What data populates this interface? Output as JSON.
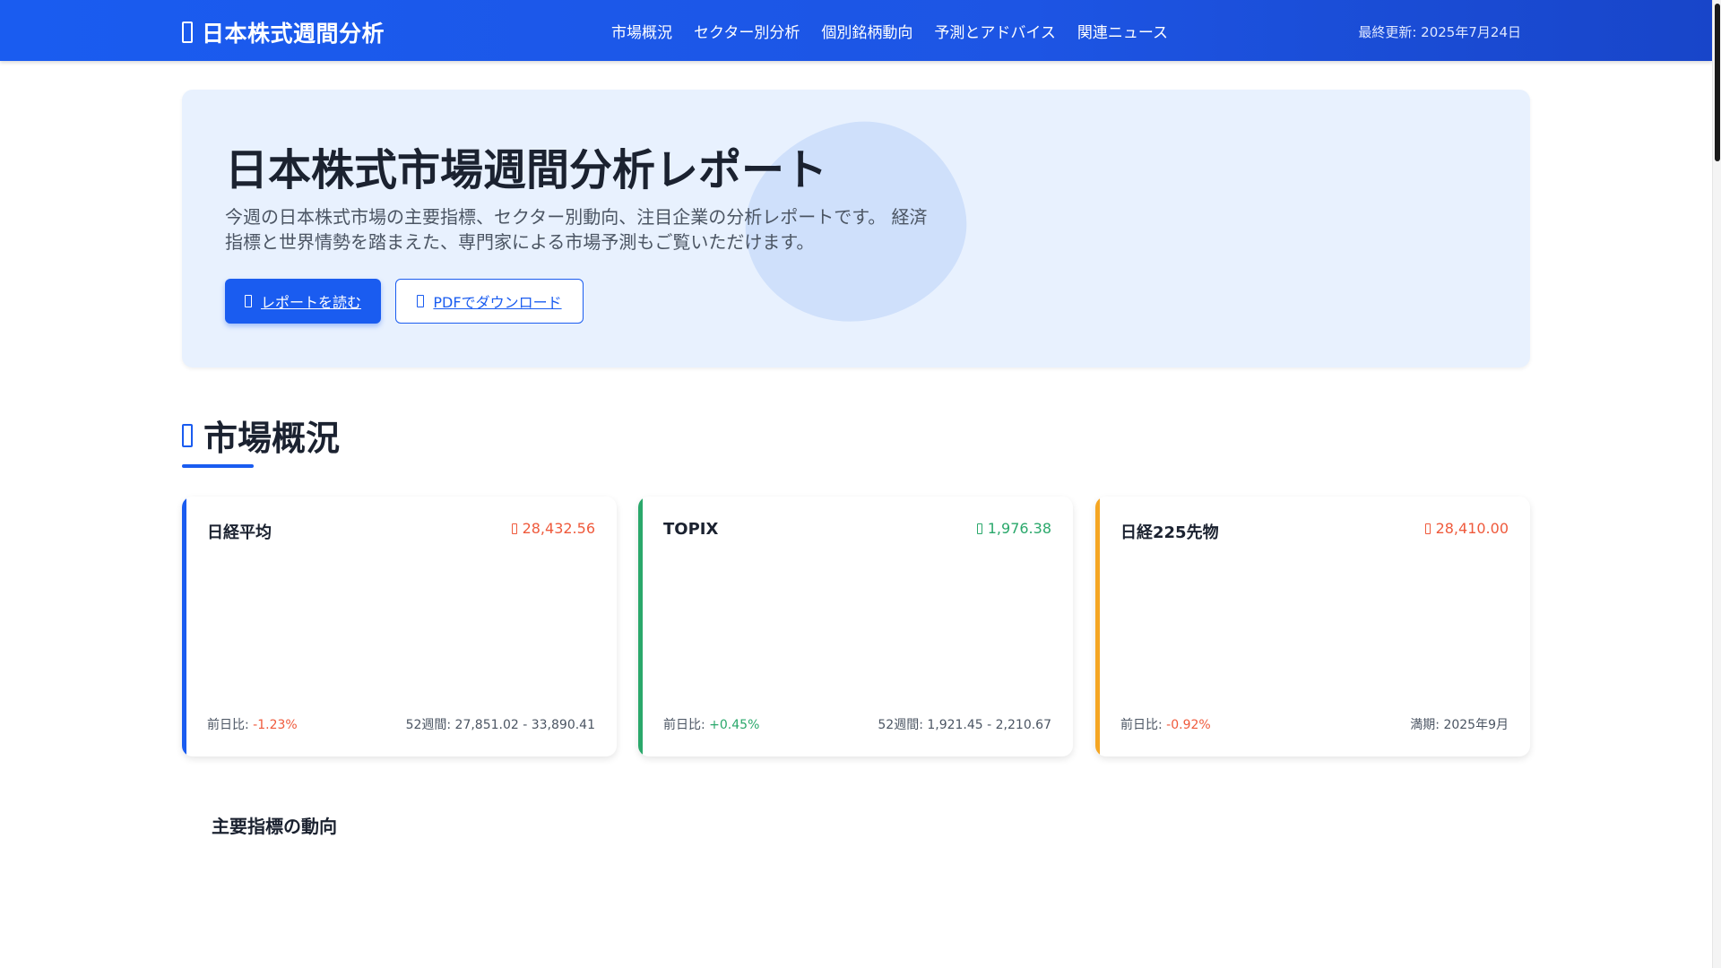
{
  "header": {
    "brand": "日本株式週間分析",
    "nav": [
      "市場概況",
      "セクター別分析",
      "個別銘柄動向",
      "予測とアドバイス",
      "関連ニュース"
    ],
    "updated": "最終更新: 2025年7月24日"
  },
  "hero": {
    "title": "日本株式市場週間分析レポート",
    "description": "今週の日本株式市場の主要指標、セクター別動向、注目企業の分析レポートです。 経済指標と世界情勢を踏まえた、専門家による市場予測もご覧いただけます。",
    "primary_button": "レポートを読む",
    "secondary_button": "PDFでダウンロード"
  },
  "market": {
    "title": "市場概況",
    "cards": [
      {
        "name": "日経平均",
        "price": "28,432.56",
        "change_label": "前日比:",
        "change": "-1.23%",
        "range": "52週間: 27,851.02 - 33,890.41",
        "trend": "down",
        "color": "#1a5cf0"
      },
      {
        "name": "TOPIX",
        "price": "1,976.38",
        "change_label": "前日比:",
        "change": "+0.45%",
        "range": "52週間: 1,921.45 - 2,210.67",
        "trend": "up",
        "color": "#2aa86b"
      },
      {
        "name": "日経225先物",
        "price": "28,410.00",
        "change_label": "前日比:",
        "change": "-0.92%",
        "range": "満期: 2025年9月",
        "trend": "down",
        "color": "#f5a623"
      }
    ],
    "indicators_title": "主要指標の動向"
  },
  "colors": {
    "accent": "#1a5cf0",
    "up": "#2aa86b",
    "down": "#ef5a3c",
    "hero_bg": "#e8f1fe"
  }
}
